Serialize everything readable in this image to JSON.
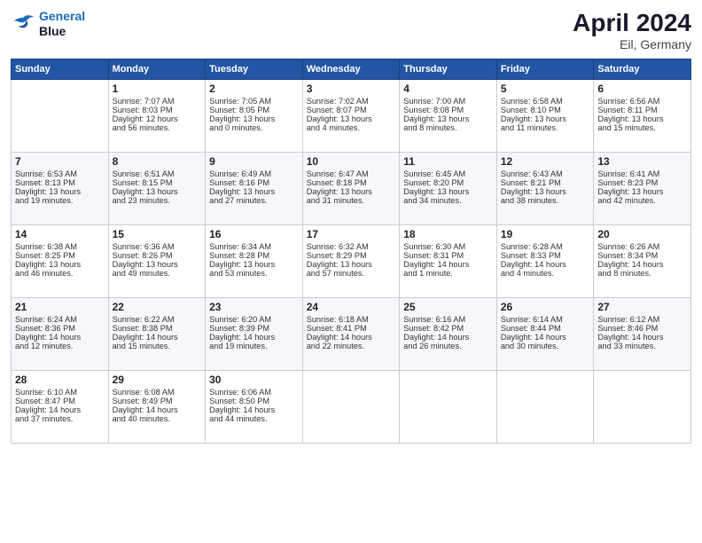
{
  "header": {
    "logo_line1": "General",
    "logo_line2": "Blue",
    "month_year": "April 2024",
    "location": "Eil, Germany"
  },
  "days_of_week": [
    "Sunday",
    "Monday",
    "Tuesday",
    "Wednesday",
    "Thursday",
    "Friday",
    "Saturday"
  ],
  "weeks": [
    [
      {
        "day": "",
        "info": ""
      },
      {
        "day": "1",
        "info": "Sunrise: 7:07 AM\nSunset: 8:03 PM\nDaylight: 12 hours\nand 56 minutes."
      },
      {
        "day": "2",
        "info": "Sunrise: 7:05 AM\nSunset: 8:05 PM\nDaylight: 13 hours\nand 0 minutes."
      },
      {
        "day": "3",
        "info": "Sunrise: 7:02 AM\nSunset: 8:07 PM\nDaylight: 13 hours\nand 4 minutes."
      },
      {
        "day": "4",
        "info": "Sunrise: 7:00 AM\nSunset: 8:08 PM\nDaylight: 13 hours\nand 8 minutes."
      },
      {
        "day": "5",
        "info": "Sunrise: 6:58 AM\nSunset: 8:10 PM\nDaylight: 13 hours\nand 11 minutes."
      },
      {
        "day": "6",
        "info": "Sunrise: 6:56 AM\nSunset: 8:11 PM\nDaylight: 13 hours\nand 15 minutes."
      }
    ],
    [
      {
        "day": "7",
        "info": "Sunrise: 6:53 AM\nSunset: 8:13 PM\nDaylight: 13 hours\nand 19 minutes."
      },
      {
        "day": "8",
        "info": "Sunrise: 6:51 AM\nSunset: 8:15 PM\nDaylight: 13 hours\nand 23 minutes."
      },
      {
        "day": "9",
        "info": "Sunrise: 6:49 AM\nSunset: 8:16 PM\nDaylight: 13 hours\nand 27 minutes."
      },
      {
        "day": "10",
        "info": "Sunrise: 6:47 AM\nSunset: 8:18 PM\nDaylight: 13 hours\nand 31 minutes."
      },
      {
        "day": "11",
        "info": "Sunrise: 6:45 AM\nSunset: 8:20 PM\nDaylight: 13 hours\nand 34 minutes."
      },
      {
        "day": "12",
        "info": "Sunrise: 6:43 AM\nSunset: 8:21 PM\nDaylight: 13 hours\nand 38 minutes."
      },
      {
        "day": "13",
        "info": "Sunrise: 6:41 AM\nSunset: 8:23 PM\nDaylight: 13 hours\nand 42 minutes."
      }
    ],
    [
      {
        "day": "14",
        "info": "Sunrise: 6:38 AM\nSunset: 8:25 PM\nDaylight: 13 hours\nand 46 minutes."
      },
      {
        "day": "15",
        "info": "Sunrise: 6:36 AM\nSunset: 8:26 PM\nDaylight: 13 hours\nand 49 minutes."
      },
      {
        "day": "16",
        "info": "Sunrise: 6:34 AM\nSunset: 8:28 PM\nDaylight: 13 hours\nand 53 minutes."
      },
      {
        "day": "17",
        "info": "Sunrise: 6:32 AM\nSunset: 8:29 PM\nDaylight: 13 hours\nand 57 minutes."
      },
      {
        "day": "18",
        "info": "Sunrise: 6:30 AM\nSunset: 8:31 PM\nDaylight: 14 hours\nand 1 minute."
      },
      {
        "day": "19",
        "info": "Sunrise: 6:28 AM\nSunset: 8:33 PM\nDaylight: 14 hours\nand 4 minutes."
      },
      {
        "day": "20",
        "info": "Sunrise: 6:26 AM\nSunset: 8:34 PM\nDaylight: 14 hours\nand 8 minutes."
      }
    ],
    [
      {
        "day": "21",
        "info": "Sunrise: 6:24 AM\nSunset: 8:36 PM\nDaylight: 14 hours\nand 12 minutes."
      },
      {
        "day": "22",
        "info": "Sunrise: 6:22 AM\nSunset: 8:38 PM\nDaylight: 14 hours\nand 15 minutes."
      },
      {
        "day": "23",
        "info": "Sunrise: 6:20 AM\nSunset: 8:39 PM\nDaylight: 14 hours\nand 19 minutes."
      },
      {
        "day": "24",
        "info": "Sunrise: 6:18 AM\nSunset: 8:41 PM\nDaylight: 14 hours\nand 22 minutes."
      },
      {
        "day": "25",
        "info": "Sunrise: 6:16 AM\nSunset: 8:42 PM\nDaylight: 14 hours\nand 26 minutes."
      },
      {
        "day": "26",
        "info": "Sunrise: 6:14 AM\nSunset: 8:44 PM\nDaylight: 14 hours\nand 30 minutes."
      },
      {
        "day": "27",
        "info": "Sunrise: 6:12 AM\nSunset: 8:46 PM\nDaylight: 14 hours\nand 33 minutes."
      }
    ],
    [
      {
        "day": "28",
        "info": "Sunrise: 6:10 AM\nSunset: 8:47 PM\nDaylight: 14 hours\nand 37 minutes."
      },
      {
        "day": "29",
        "info": "Sunrise: 6:08 AM\nSunset: 8:49 PM\nDaylight: 14 hours\nand 40 minutes."
      },
      {
        "day": "30",
        "info": "Sunrise: 6:06 AM\nSunset: 8:50 PM\nDaylight: 14 hours\nand 44 minutes."
      },
      {
        "day": "",
        "info": ""
      },
      {
        "day": "",
        "info": ""
      },
      {
        "day": "",
        "info": ""
      },
      {
        "day": "",
        "info": ""
      }
    ]
  ]
}
